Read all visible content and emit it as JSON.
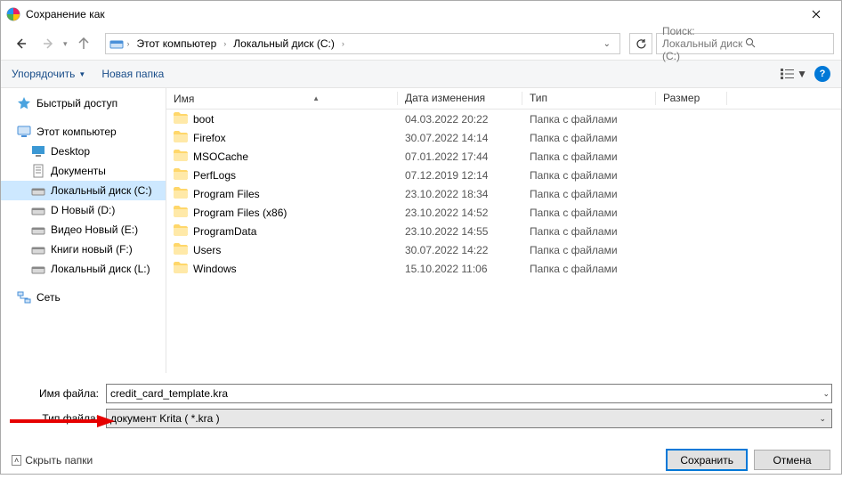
{
  "window": {
    "title": "Сохранение как"
  },
  "nav": {
    "breadcrumb": [
      "Этот компьютер",
      "Локальный диск (C:)"
    ],
    "search_placeholder": "Поиск: Локальный диск (C:)"
  },
  "toolbar": {
    "organize": "Упорядочить",
    "new_folder": "Новая папка"
  },
  "sidebar": {
    "quick": "Быстрый доступ",
    "thispc": "Этот компьютер",
    "items": [
      "Desktop",
      "Документы",
      "Локальный диск (C:)",
      "D Новый (D:)",
      "Видео Новый (E:)",
      "Книги новый (F:)",
      "Локальный диск (L:)"
    ],
    "network": "Сеть"
  },
  "columns": {
    "name": "Имя",
    "date": "Дата изменения",
    "type": "Тип",
    "size": "Размер"
  },
  "rows": [
    {
      "name": "boot",
      "date": "04.03.2022 20:22",
      "type": "Папка с файлами"
    },
    {
      "name": "Firefox",
      "date": "30.07.2022 14:14",
      "type": "Папка с файлами"
    },
    {
      "name": "MSOCache",
      "date": "07.01.2022 17:44",
      "type": "Папка с файлами"
    },
    {
      "name": "PerfLogs",
      "date": "07.12.2019 12:14",
      "type": "Папка с файлами"
    },
    {
      "name": "Program Files",
      "date": "23.10.2022 18:34",
      "type": "Папка с файлами"
    },
    {
      "name": "Program Files (x86)",
      "date": "23.10.2022 14:52",
      "type": "Папка с файлами"
    },
    {
      "name": "ProgramData",
      "date": "23.10.2022 14:55",
      "type": "Папка с файлами"
    },
    {
      "name": "Users",
      "date": "30.07.2022 14:22",
      "type": "Папка с файлами"
    },
    {
      "name": "Windows",
      "date": "15.10.2022 11:06",
      "type": "Папка с файлами"
    }
  ],
  "fields": {
    "filename_label": "Имя файла:",
    "filename_value": "credit_card_template.kra",
    "filetype_label": "Тип файла:",
    "filetype_value": "документ Krita ( *.kra )"
  },
  "footer": {
    "hide_folders": "Скрыть папки",
    "save": "Сохранить",
    "cancel": "Отмена"
  }
}
